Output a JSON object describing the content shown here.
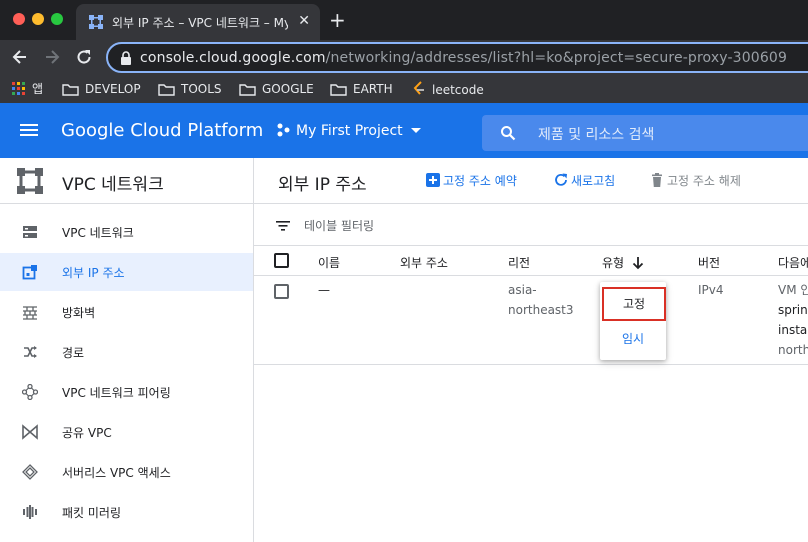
{
  "browser": {
    "tab_title": "외부 IP 주소 – VPC 네트워크 – My First Project – Google Cloud Platform",
    "tab_close": "✕",
    "new_tab": "+",
    "url_host": "console.cloud.google.com",
    "url_path": "/networking/addresses/list?hl=ko&project=secure-proxy-300609",
    "bookmarks": [
      {
        "label": "앱",
        "icon": "apps-grid-icon"
      },
      {
        "label": "DEVELOP",
        "icon": "folder-icon"
      },
      {
        "label": "TOOLS",
        "icon": "folder-icon"
      },
      {
        "label": "GOOGLE",
        "icon": "folder-icon"
      },
      {
        "label": "EARTH",
        "icon": "folder-icon"
      },
      {
        "label": "leetcode",
        "icon": "leetcode-icon"
      }
    ]
  },
  "header": {
    "logo": "Google Cloud Platform",
    "project": "My First Project",
    "search_placeholder": "제품 및 리소스 검색",
    "color": "#1a73e8"
  },
  "sidebar": {
    "title": "VPC 네트워크",
    "items": [
      {
        "label": "VPC 네트워크",
        "icon": "vpc-network-icon",
        "active": false
      },
      {
        "label": "외부 IP 주소",
        "icon": "external-ip-icon",
        "active": true
      },
      {
        "label": "방화벽",
        "icon": "firewall-icon",
        "active": false
      },
      {
        "label": "경로",
        "icon": "routes-icon",
        "active": false
      },
      {
        "label": "VPC 네트워크 피어링",
        "icon": "peering-icon",
        "active": false
      },
      {
        "label": "공유 VPC",
        "icon": "shared-vpc-icon",
        "active": false
      },
      {
        "label": "서버리스 VPC 액세스",
        "icon": "serverless-icon",
        "active": false
      },
      {
        "label": "패킷 미러링",
        "icon": "packet-mirroring-icon",
        "active": false
      }
    ]
  },
  "main": {
    "title": "외부 IP 주소",
    "actions": {
      "reserve": "고정 주소 예약",
      "refresh": "새로고침",
      "release": "고정 주소 해제"
    },
    "filter_placeholder": "테이블 필터링",
    "columns": [
      "이름",
      "외부 주소",
      "리전",
      "유형",
      "버전",
      "다음에"
    ],
    "row": {
      "name": "—",
      "region_line1": "asia-",
      "region_line2": "northeast3",
      "version": "IPv4",
      "usedby_line1": "VM 인",
      "usedby_line2": "sprin",
      "usedby_line3": "insta",
      "usedby_line4": "north"
    },
    "type_menu": {
      "options": [
        "고정",
        "임시"
      ],
      "selected": "고정"
    }
  }
}
